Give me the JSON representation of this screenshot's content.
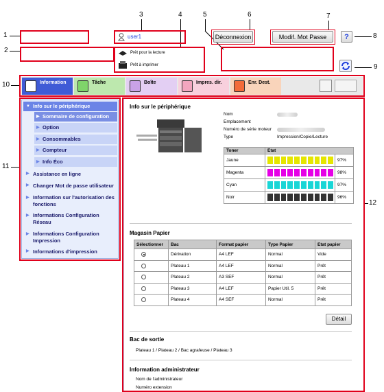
{
  "callouts": [
    "1",
    "2",
    "3",
    "4",
    "5",
    "6",
    "7",
    "8",
    "9",
    "10",
    "11",
    "12"
  ],
  "header": {
    "user_name": "user1",
    "logout_label": "Déconnexion",
    "change_password_label": "Modif. Mot Passe",
    "help_label": "?",
    "status_ready_print": "Prêt pour la lecture",
    "status_ready_scan": "Prêt à imprimer"
  },
  "tabs": [
    {
      "label": "Information",
      "color": "#3f5bd6"
    },
    {
      "label": "Tâche",
      "color": "#7fd46a"
    },
    {
      "label": "Boîte",
      "color": "#c9a2e6"
    },
    {
      "label": "Impres. dir.",
      "color": "#f3a6bf"
    },
    {
      "label": "Enr. Dest.",
      "color": "#f5b080"
    }
  ],
  "sidebar": {
    "head": "Info sur le périphérique",
    "subs": [
      "Sommaire de configuration",
      "Option",
      "Consommables",
      "Compteur",
      "Info Éco"
    ],
    "items": [
      "Assistance en ligne",
      "Changer Mot de passe utilisateur",
      "Information sur l'autorisation des fonctions",
      "Informations Configuration Réseau",
      "Informations Configuration Impression",
      "Informations d'impression"
    ]
  },
  "device": {
    "title": "Info sur le périphérique",
    "labels": [
      "Nom",
      "Emplacement",
      "Numéro de série moteur",
      "Type"
    ],
    "type_value": "Impression/Copie/Lecture"
  },
  "toner": {
    "headers": [
      "Toner",
      "Etat"
    ],
    "rows": [
      {
        "name": "Jaune",
        "pct": "97%",
        "color": "#e6e600"
      },
      {
        "name": "Magenta",
        "pct": "98%",
        "color": "#e600e6"
      },
      {
        "name": "Cyan",
        "pct": "97%",
        "color": "#19d6d6"
      },
      {
        "name": "Noir",
        "pct": "96%",
        "color": "#333333"
      }
    ]
  },
  "paper": {
    "title": "Magasin Papier",
    "headers": [
      "Sélectionner",
      "Bac",
      "Format papier",
      "Type Papier",
      "Etat papier"
    ],
    "rows": [
      {
        "selected": true,
        "bac": "Dérivation",
        "format": "A4 LEF",
        "type": "Normal",
        "etat": "Vide"
      },
      {
        "selected": false,
        "bac": "Plateau 1",
        "format": "A4 LEF",
        "type": "Normal",
        "etat": "Prêt"
      },
      {
        "selected": false,
        "bac": "Plateau 2",
        "format": "A3 SEF",
        "type": "Normal",
        "etat": "Prêt"
      },
      {
        "selected": false,
        "bac": "Plateau 3",
        "format": "A4 LEF",
        "type": "Papier Util. 5",
        "etat": "Prêt"
      },
      {
        "selected": false,
        "bac": "Plateau 4",
        "format": "A4 SEF",
        "type": "Normal",
        "etat": "Prêt"
      }
    ],
    "detail_label": "Détail"
  },
  "output": {
    "title": "Bac de sortie",
    "value": "Plateau 1 / Plateau 2 / Bac agrafeuse / Plateau 3"
  },
  "admin": {
    "title": "Information administrateur",
    "labels": [
      "Nom de l'administrateur",
      "Numéro extension"
    ]
  }
}
